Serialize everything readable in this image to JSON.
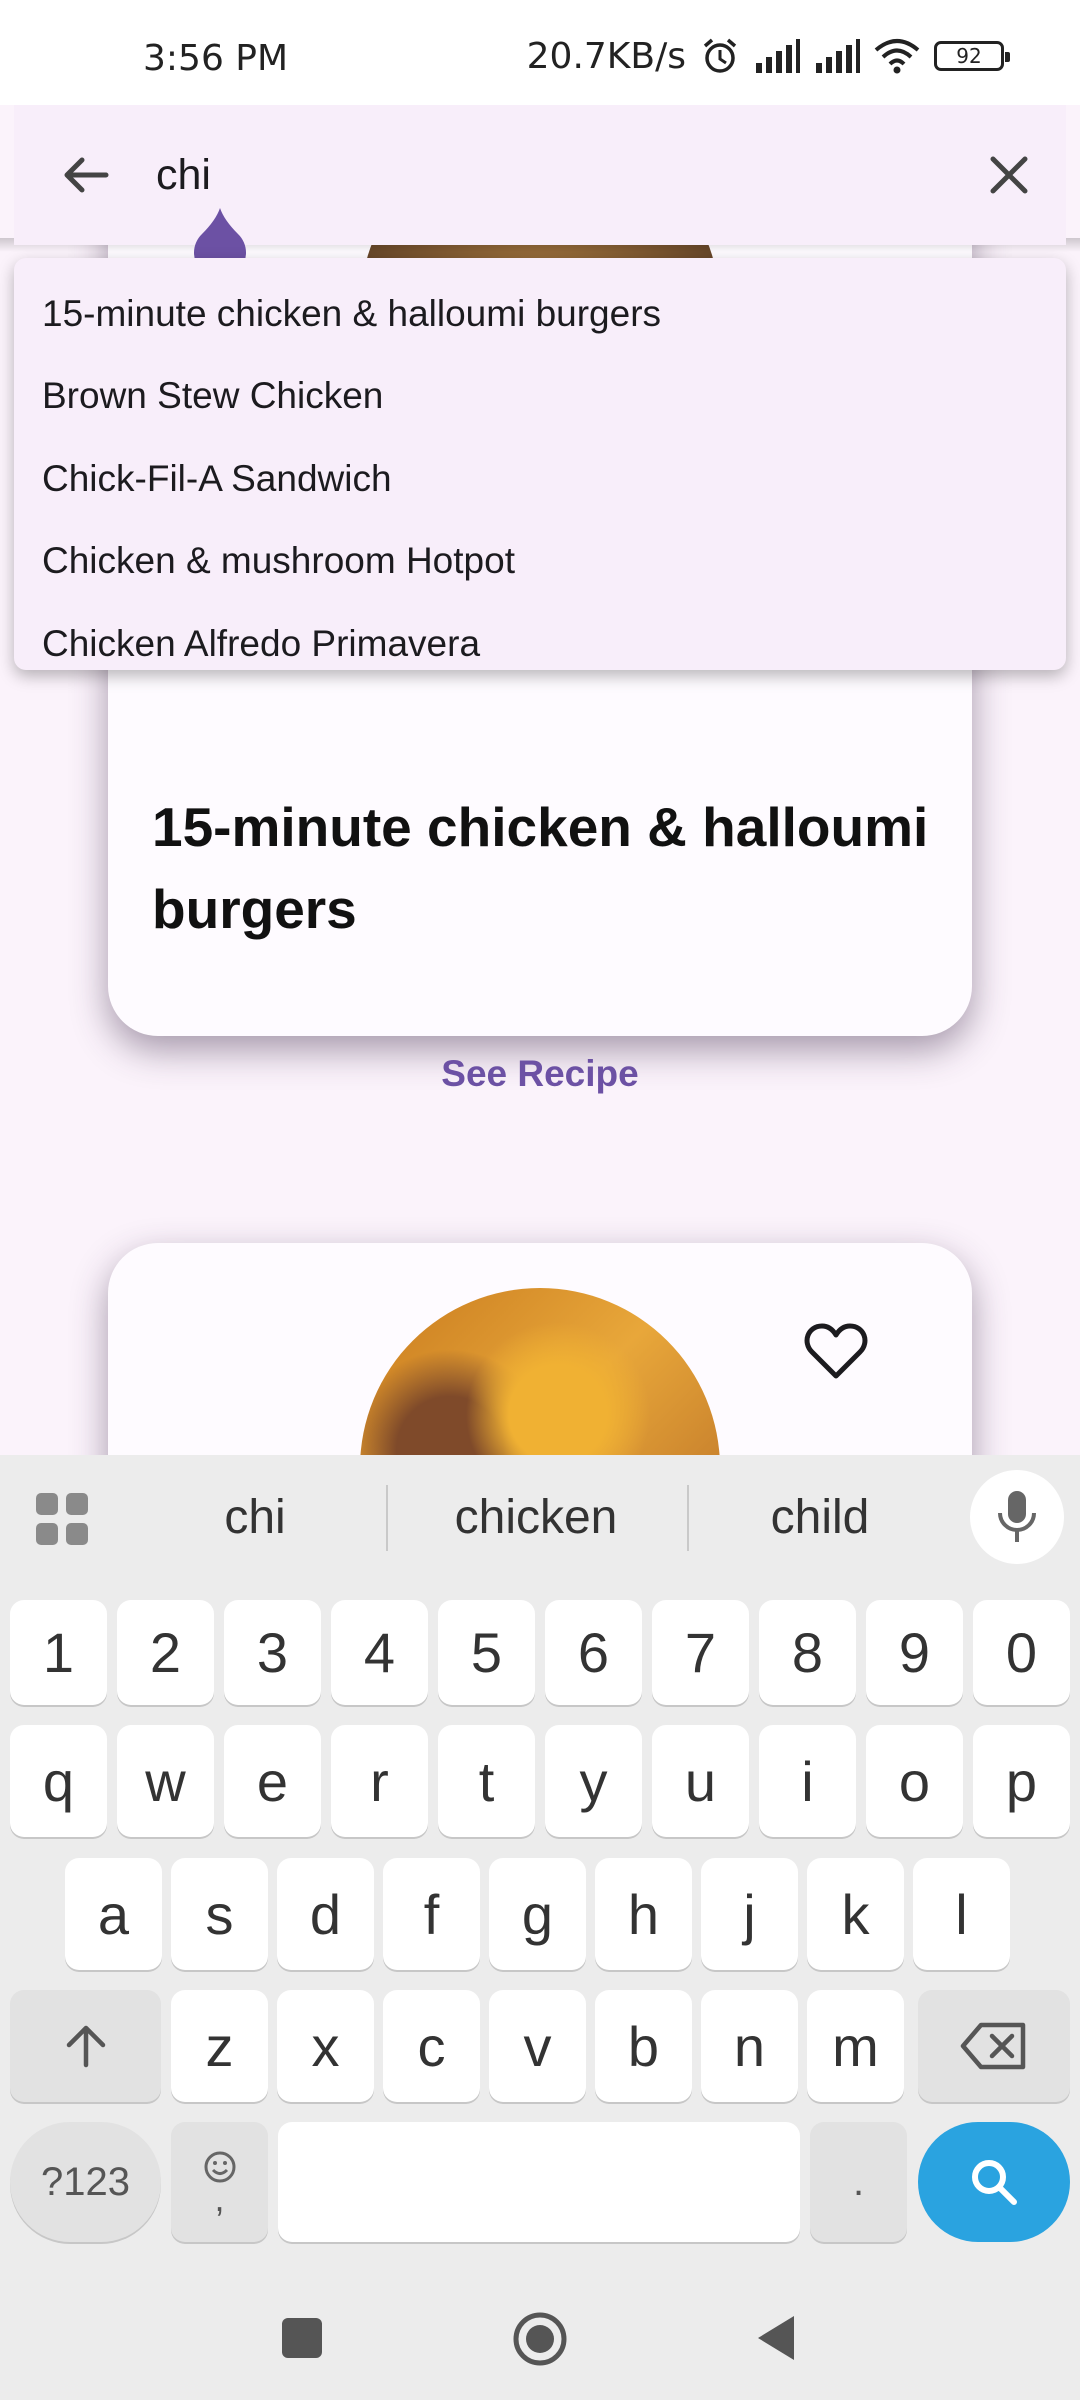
{
  "status_bar": {
    "time": "3:56 PM",
    "network_speed": "20.7KB/s",
    "battery": "92",
    "icons": [
      "alarm-icon",
      "signal-icon",
      "signal-icon",
      "wifi-icon",
      "battery-icon"
    ]
  },
  "search": {
    "query": "chi",
    "back_icon": "arrow-back-icon",
    "clear_icon": "close-icon"
  },
  "suggestions": [
    "15-minute chicken & halloumi burgers",
    "Brown Stew Chicken",
    "Chick-Fil-A Sandwich",
    "Chicken & mushroom Hotpot",
    "Chicken Alfredo Primavera"
  ],
  "recipes": [
    {
      "title": "15-minute chicken & halloumi burgers",
      "action": "See Recipe"
    },
    {
      "favorite_icon": "heart-outline-icon"
    }
  ],
  "keyboard": {
    "word_suggestions": [
      "chi",
      "chicken",
      "child"
    ],
    "number_row": [
      "1",
      "2",
      "3",
      "4",
      "5",
      "6",
      "7",
      "8",
      "9",
      "0"
    ],
    "row1": [
      "q",
      "w",
      "e",
      "r",
      "t",
      "y",
      "u",
      "i",
      "o",
      "p"
    ],
    "row2": [
      "a",
      "s",
      "d",
      "f",
      "g",
      "h",
      "j",
      "k",
      "l"
    ],
    "row3": [
      "z",
      "x",
      "c",
      "v",
      "b",
      "n",
      "m"
    ],
    "symbols_key": "?123",
    "emoji_key_comma": ",",
    "period_key": ".",
    "accent_color": "#2aa3e0"
  },
  "theme": {
    "primary": "#6c51a4",
    "surface": "#f8eefa",
    "background": "#fbf3fb"
  }
}
